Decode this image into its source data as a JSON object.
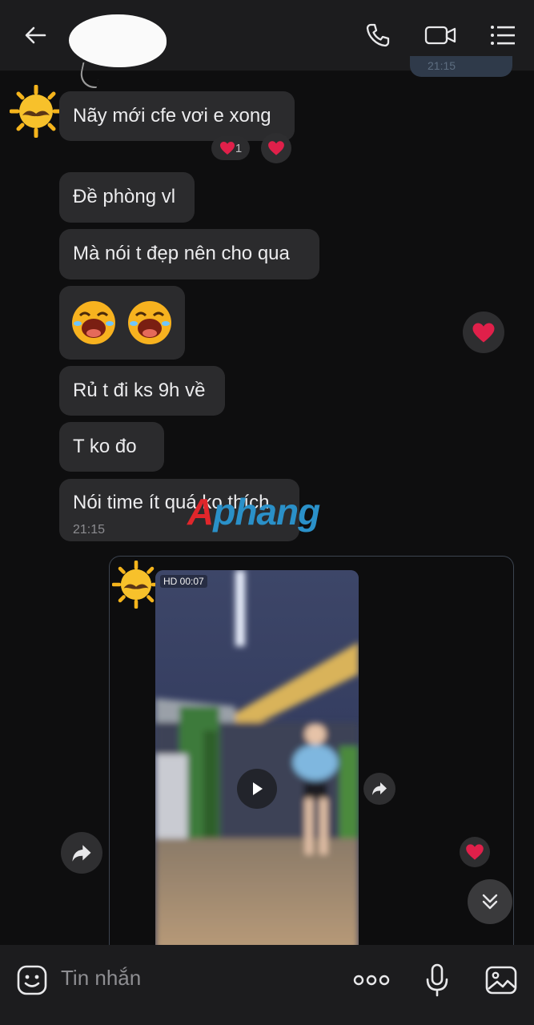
{
  "header": {
    "back_icon": "arrow-left-icon",
    "call_icon": "phone-icon",
    "video_call_icon": "video-camera-icon",
    "menu_icon": "list-menu-icon"
  },
  "messages": [
    {
      "text": "Nãy mới cfe vơi e xong",
      "reaction_count": "1"
    },
    {
      "text": "Đề phòng vl"
    },
    {
      "text": "Mà nói t đẹp nên cho qua"
    },
    {
      "text": "emoji-laughing x2"
    },
    {
      "text": "Rủ t đi ks 9h về"
    },
    {
      "text": "T ko đo"
    },
    {
      "text": "Nói time ít quá ko thích",
      "time": "21:15"
    }
  ],
  "watermark": {
    "part1": "A",
    "part2": "phang"
  },
  "video": {
    "label": "HD 00:07",
    "play_icon": "play-icon"
  },
  "composer": {
    "placeholder": "Tin nhắn",
    "sticker_icon": "emoji-face-icon",
    "more_icon": "more-dots-icon",
    "mic_icon": "microphone-icon",
    "image_icon": "image-icon"
  },
  "colors": {
    "accent_heart": "#e0204a",
    "bubble": "#2b2b2d",
    "background": "#0e0e0f"
  }
}
